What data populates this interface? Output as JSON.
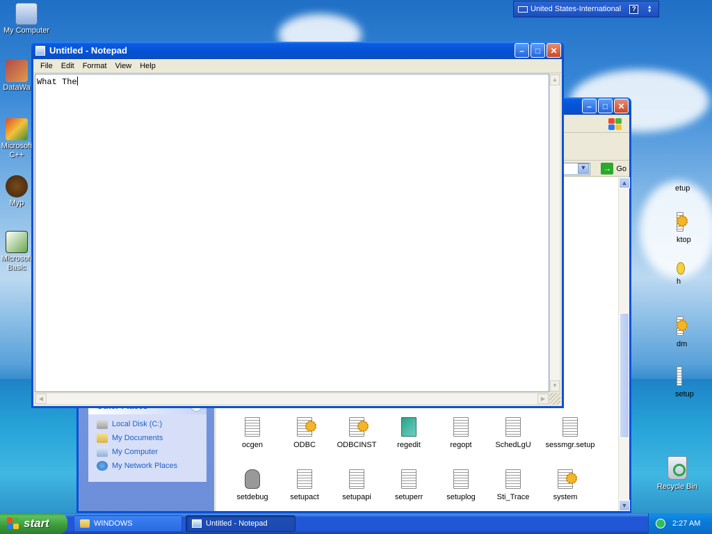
{
  "desktop": {
    "icons": [
      {
        "label": "My Computer",
        "icon": "computer-icon"
      },
      {
        "label": "DataWa",
        "icon": "datawarehouse-icon"
      },
      {
        "label": "Microsoft C++",
        "icon": "msvc-icon"
      },
      {
        "label": "Myp",
        "icon": "myp-icon"
      },
      {
        "label": "Microsoft Basic",
        "icon": "msbasic-icon"
      }
    ],
    "recycle_bin": "Recycle Bin"
  },
  "language_bar": {
    "label": "United States-International",
    "help": "?"
  },
  "notepad": {
    "title": "Untitled - Notepad",
    "menu": [
      "File",
      "Edit",
      "Format",
      "View",
      "Help"
    ],
    "content": "What The"
  },
  "explorer": {
    "address_go": "Go",
    "other_places": {
      "title": "Other Places",
      "items": [
        "Local Disk (C:)",
        "My Documents",
        "My Computer",
        "My Network Places"
      ]
    },
    "right_column_partial": [
      "etup",
      "ktop",
      "h",
      "dm",
      "setup"
    ],
    "files_row1": [
      "ocgen",
      "ODBC",
      "ODBCINST",
      "regedit",
      "regopt",
      "SchedLgU",
      "sessmgr.setup"
    ],
    "files_row2": [
      "setdebug",
      "setupact",
      "setupapi",
      "setuperr",
      "setuplog",
      "Sti_Trace",
      "system"
    ]
  },
  "taskbar": {
    "start": "start",
    "tasks": [
      "WINDOWS",
      "Untitled - Notepad"
    ],
    "clock": "2:27 AM"
  },
  "colors": {
    "xp_blue": "#0a51d8",
    "start_green": "#3a9a3a",
    "link_blue": "#215dc6"
  }
}
